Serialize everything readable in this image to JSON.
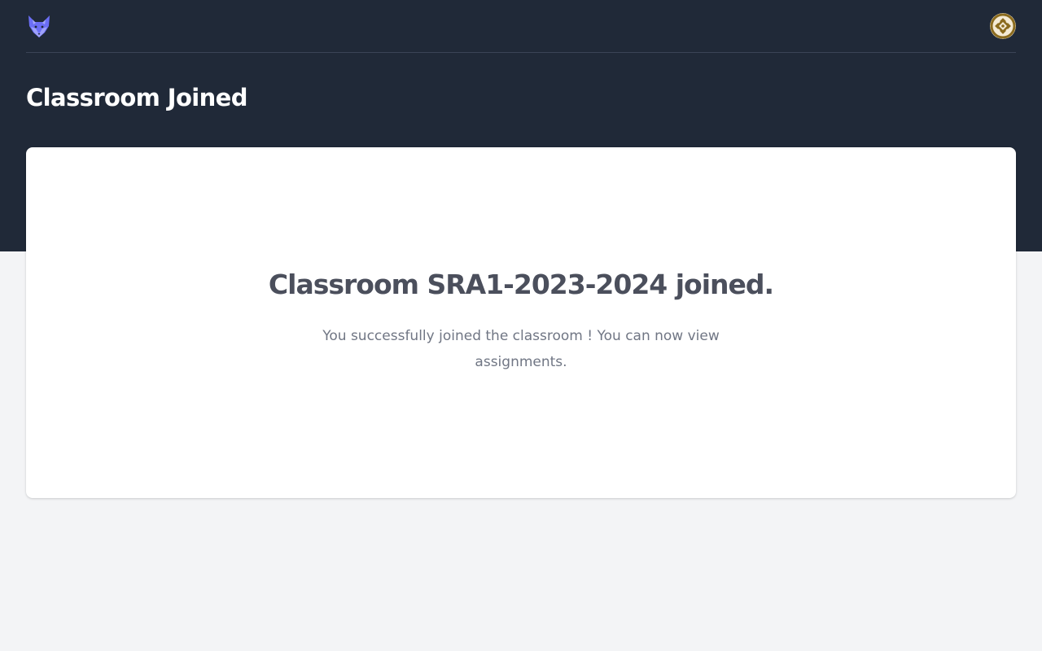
{
  "header": {
    "logo_icon": "fox-logo-icon",
    "avatar_icon": "user-avatar-icon",
    "page_title": "Classroom Joined"
  },
  "card": {
    "heading": "Classroom SRA1-2023-2024 joined.",
    "message": "You successfully joined the classroom ! You can now view assignments."
  },
  "colors": {
    "header_bg": "#202938",
    "page_bg": "#f3f4f6",
    "card_bg": "#ffffff",
    "logo_purple": "#6b6ef5",
    "avatar_gold": "#8b6b1e"
  }
}
